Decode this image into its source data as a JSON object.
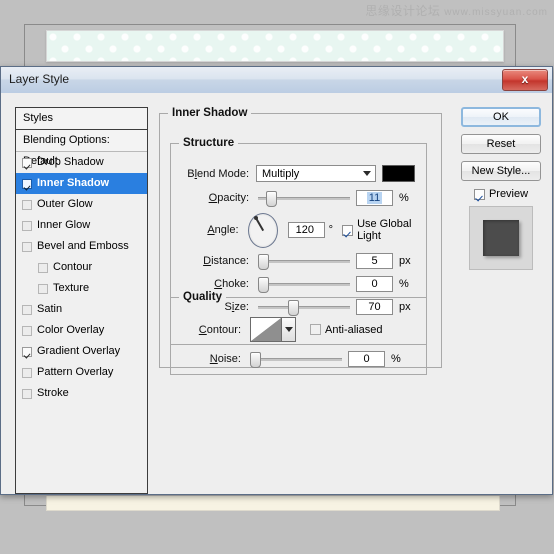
{
  "watermark": {
    "cn": "思缘设计论坛",
    "url": "www.missyuan.com"
  },
  "dialog": {
    "title": "Layer Style",
    "close_label": "x"
  },
  "styles_panel": {
    "header": "Styles",
    "blending_options": "Blending Options: Default",
    "items": [
      {
        "label": "Drop Shadow",
        "checked": true,
        "enabled": true,
        "indent": false,
        "selected": false
      },
      {
        "label": "Inner Shadow",
        "checked": true,
        "enabled": true,
        "indent": false,
        "selected": true
      },
      {
        "label": "Outer Glow",
        "checked": false,
        "enabled": false,
        "indent": false,
        "selected": false
      },
      {
        "label": "Inner Glow",
        "checked": false,
        "enabled": false,
        "indent": false,
        "selected": false
      },
      {
        "label": "Bevel and Emboss",
        "checked": false,
        "enabled": false,
        "indent": false,
        "selected": false
      },
      {
        "label": "Contour",
        "checked": false,
        "enabled": false,
        "indent": true,
        "selected": false
      },
      {
        "label": "Texture",
        "checked": false,
        "enabled": false,
        "indent": true,
        "selected": false
      },
      {
        "label": "Satin",
        "checked": false,
        "enabled": false,
        "indent": false,
        "selected": false
      },
      {
        "label": "Color Overlay",
        "checked": false,
        "enabled": false,
        "indent": false,
        "selected": false
      },
      {
        "label": "Gradient Overlay",
        "checked": true,
        "enabled": true,
        "indent": false,
        "selected": false
      },
      {
        "label": "Pattern Overlay",
        "checked": false,
        "enabled": false,
        "indent": false,
        "selected": false
      },
      {
        "label": "Stroke",
        "checked": false,
        "enabled": false,
        "indent": false,
        "selected": false
      }
    ]
  },
  "inner_shadow": {
    "group_title": "Inner Shadow",
    "structure": {
      "title": "Structure",
      "blend_mode_label": "Blend Mode:",
      "blend_mode_value": "Multiply",
      "shadow_color": "#000000",
      "opacity_label": "Opacity:",
      "opacity_value": "11",
      "opacity_unit": "%",
      "angle_label": "Angle:",
      "angle_value": "120",
      "angle_unit": "°",
      "use_global_light": "Use Global Light",
      "use_global_light_checked": true,
      "distance_label": "Distance:",
      "distance_value": "5",
      "distance_unit": "px",
      "choke_label": "Choke:",
      "choke_value": "0",
      "choke_unit": "%",
      "size_label": "Size:",
      "size_value": "70",
      "size_unit": "px"
    },
    "quality": {
      "title": "Quality",
      "contour_label": "Contour:",
      "anti_aliased": "Anti-aliased",
      "anti_aliased_checked": false,
      "noise_label": "Noise:",
      "noise_value": "0",
      "noise_unit": "%"
    }
  },
  "buttons": {
    "ok": "OK",
    "reset": "Reset",
    "new_style": "New Style...",
    "preview": "Preview",
    "preview_checked": true
  }
}
